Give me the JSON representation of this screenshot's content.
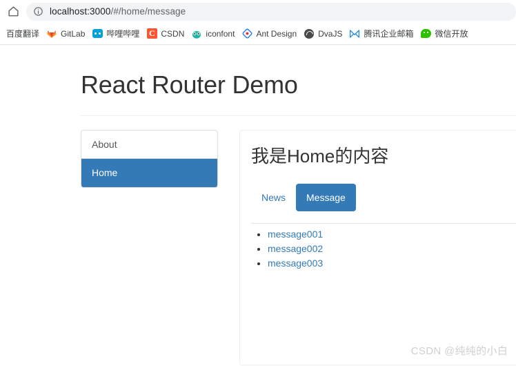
{
  "browser": {
    "home_icon": "home-icon",
    "url_bar": {
      "info_icon": "info-icon",
      "host": "localhost:3000",
      "path": "/#/home/message",
      "full_url": "localhost:3000/#/home/message"
    },
    "bookmarks": [
      {
        "label": "百度翻译",
        "icon": ""
      },
      {
        "label": "GitLab",
        "icon": "gitlab-icon"
      },
      {
        "label": "哔哩哔哩",
        "icon": "bilibili-icon"
      },
      {
        "label": "CSDN",
        "icon": "csdn-icon"
      },
      {
        "label": "iconfont",
        "icon": "iconfont-icon"
      },
      {
        "label": "Ant Design",
        "icon": "ant-design-icon"
      },
      {
        "label": "DvaJS",
        "icon": "dvajs-icon"
      },
      {
        "label": "腾讯企业邮箱",
        "icon": "tencent-exmail-icon"
      },
      {
        "label": "微信开放",
        "icon": "wechat-icon"
      }
    ]
  },
  "page": {
    "title": "React Router Demo",
    "sidebar": {
      "items": [
        {
          "label": "About",
          "active": false
        },
        {
          "label": "Home",
          "active": true
        }
      ]
    },
    "content": {
      "heading": "我是Home的内容",
      "tabs": [
        {
          "label": "News",
          "active": false
        },
        {
          "label": "Message",
          "active": true
        }
      ],
      "messages": [
        {
          "label": "message001"
        },
        {
          "label": "message002"
        },
        {
          "label": "message003"
        }
      ]
    },
    "watermark": "CSDN @纯纯的小白"
  },
  "colors": {
    "primary": "#337ab7",
    "link": "#337ab7",
    "text": "#333333",
    "border": "#dddddd",
    "watermark": "#d0d0d0"
  }
}
